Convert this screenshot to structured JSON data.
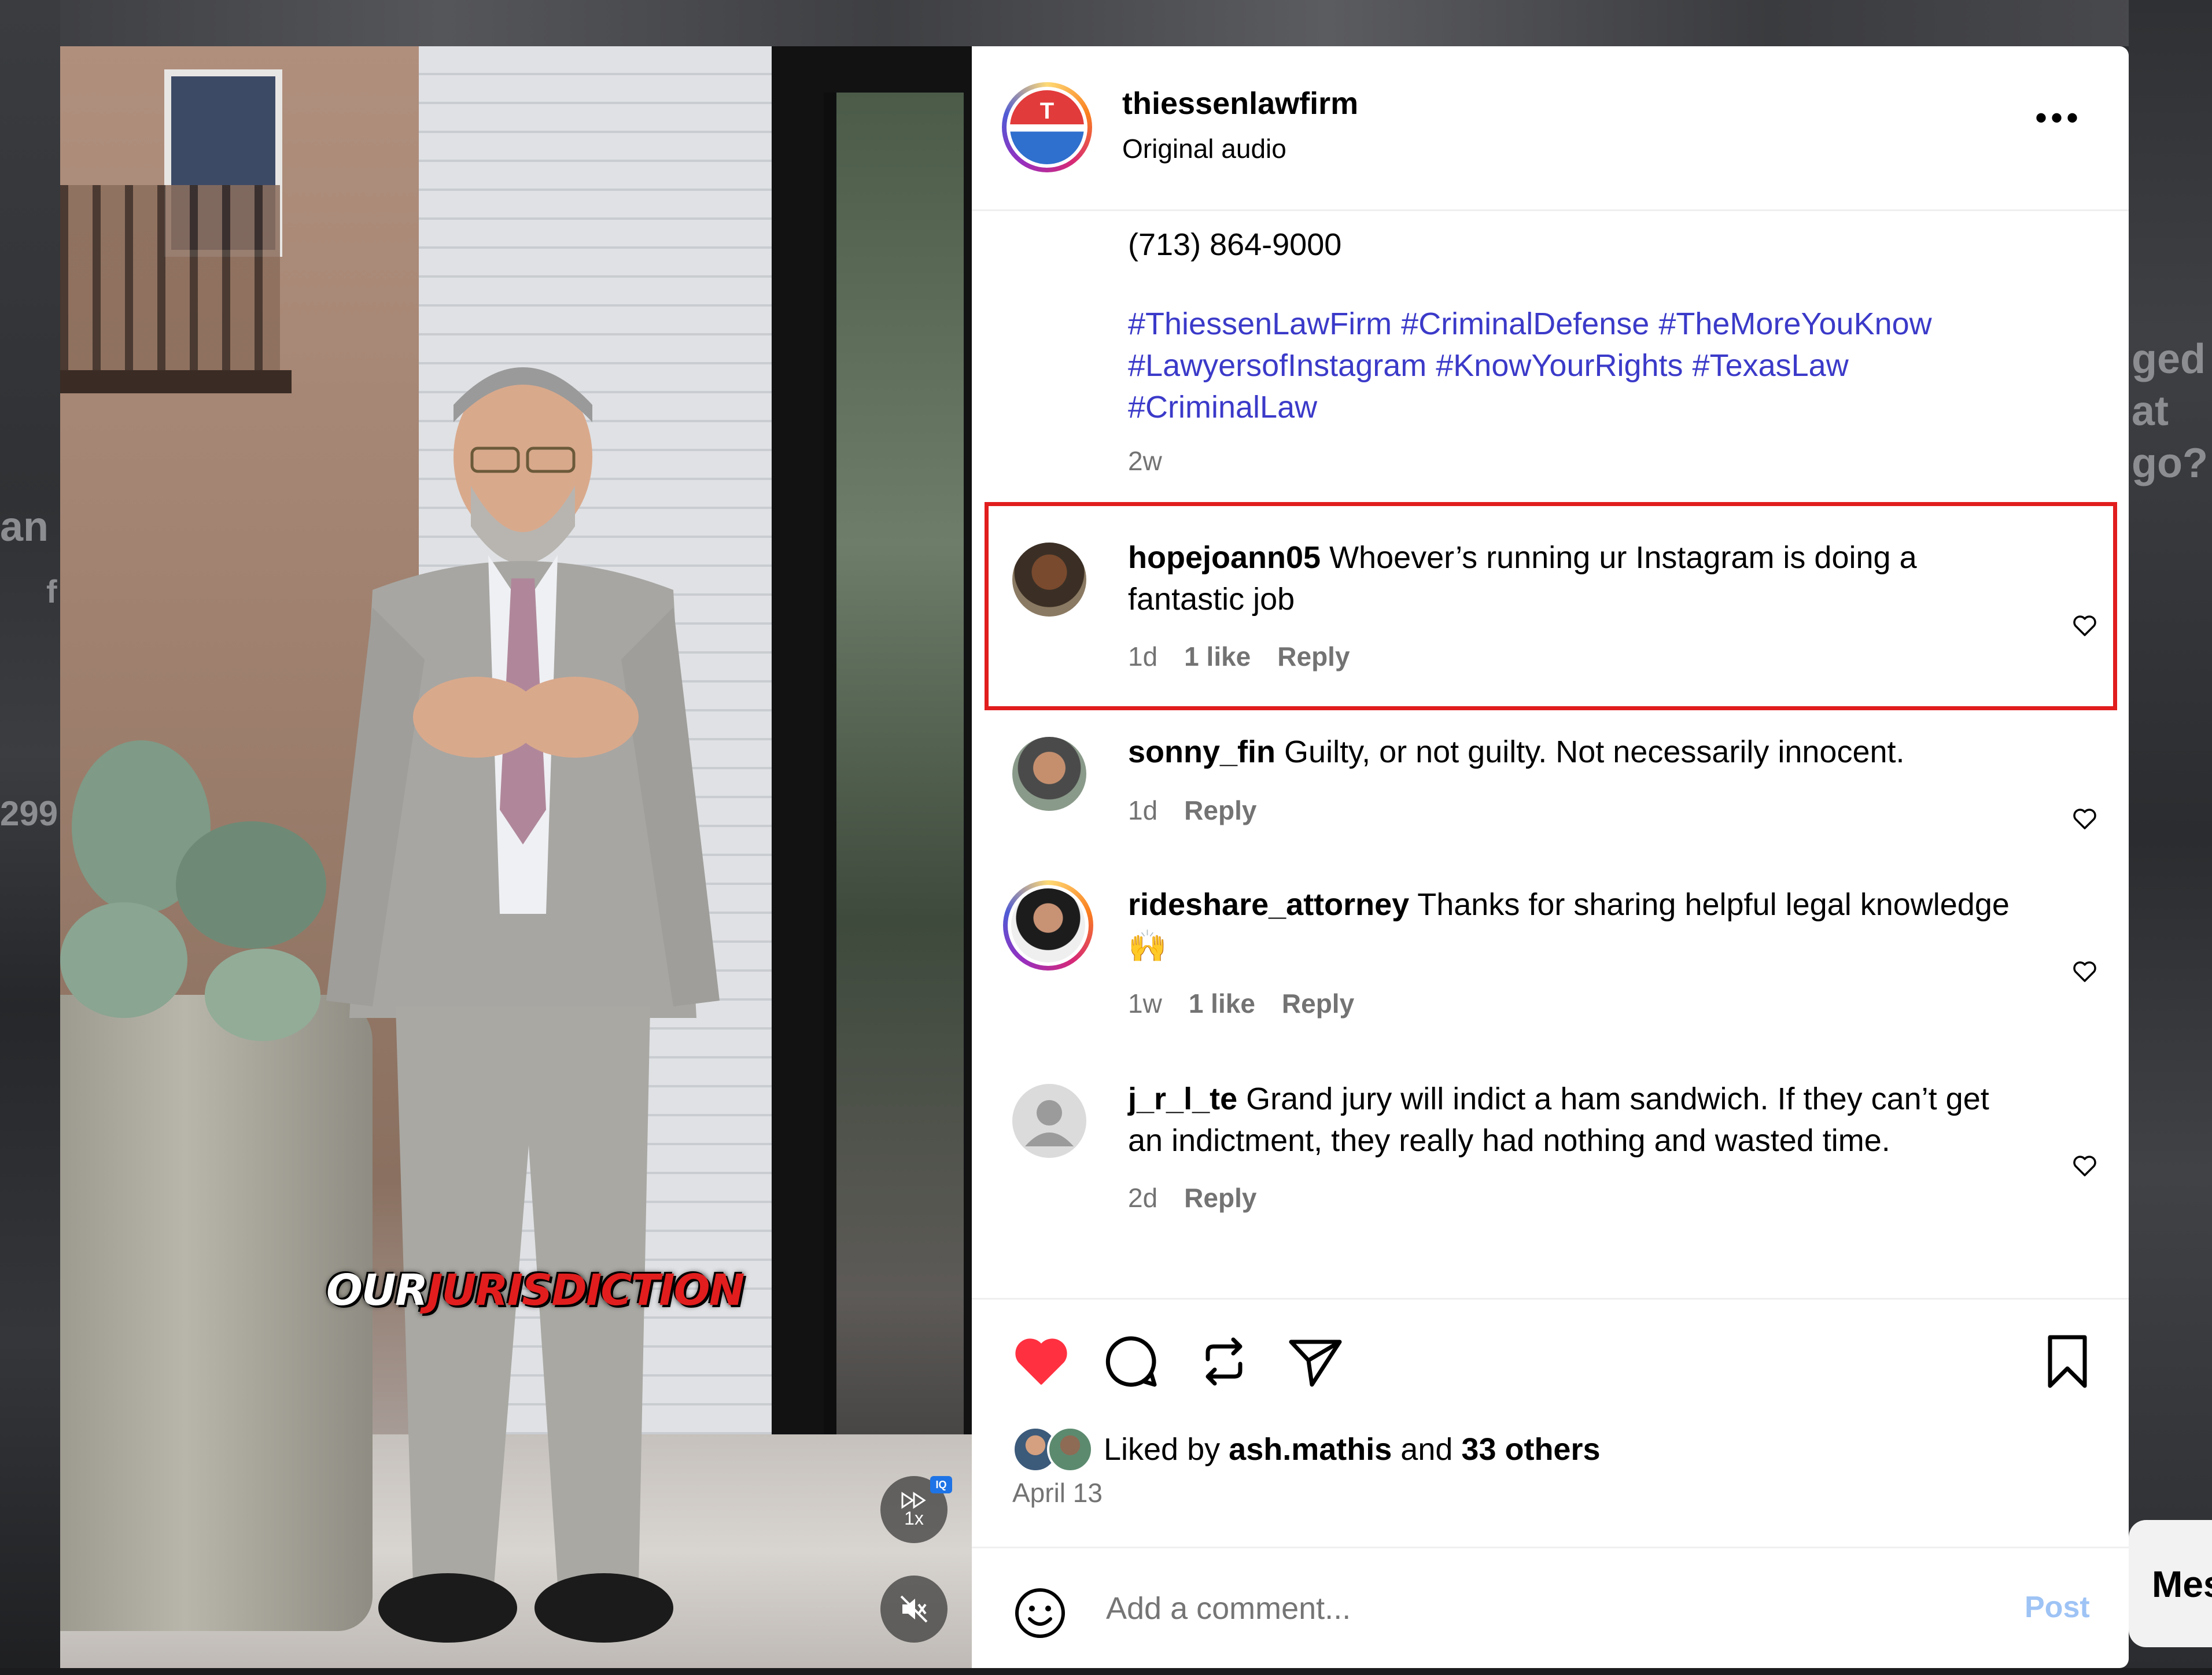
{
  "background": {
    "left_texts": [
      "an",
      "f",
      "299"
    ],
    "right_texts": [
      "ged",
      "at",
      "go?"
    ],
    "right_pill_text": "Mes"
  },
  "video": {
    "caption_white": "OUR",
    "caption_red": "JURISDICTION",
    "speed_label": "1x",
    "badge": "IQ"
  },
  "post": {
    "username": "thiessenlawfirm",
    "audio": "Original audio",
    "more_label": "•••",
    "avatar_letter": "T",
    "phone": "(713) 864-9000",
    "hashtags": [
      "#ThiessenLawFirm",
      "#CriminalDefense",
      "#TheMoreYouKnow",
      "#LawyersofInstagram",
      "#KnowYourRights",
      "#TexasLaw",
      "#CriminalLaw"
    ],
    "time": "2w"
  },
  "comments": [
    {
      "user": "hopejoann05",
      "text": "Whoever’s running ur Instagram is doing a fantastic job",
      "time": "1d",
      "likes": "1 like",
      "reply": "Reply"
    },
    {
      "user": "sonny_fin",
      "text": "Guilty, or not guilty. Not necessarily innocent.",
      "time": "1d",
      "likes": "",
      "reply": "Reply"
    },
    {
      "user": "rideshare_attorney",
      "text": "Thanks for sharing helpful legal knowledge 🙌",
      "time": "1w",
      "likes": "1 like",
      "reply": "Reply"
    },
    {
      "user": "j_r_l_te",
      "text": "Grand jury will indict a ham sandwich. If they can’t get an indictment, they really had nothing and wasted time.",
      "time": "2d",
      "likes": "",
      "reply": "Reply"
    }
  ],
  "likes": {
    "prefix": "Liked by",
    "user": "ash.mathis",
    "middle": "and",
    "others": "33 others"
  },
  "date": "April 13",
  "comment_box": {
    "placeholder": "Add a comment...",
    "post_label": "Post"
  },
  "colors": {
    "accent_blue": "#3b3ac9",
    "highlight_red": "#e11d1d",
    "like_red": "#ff3040"
  }
}
